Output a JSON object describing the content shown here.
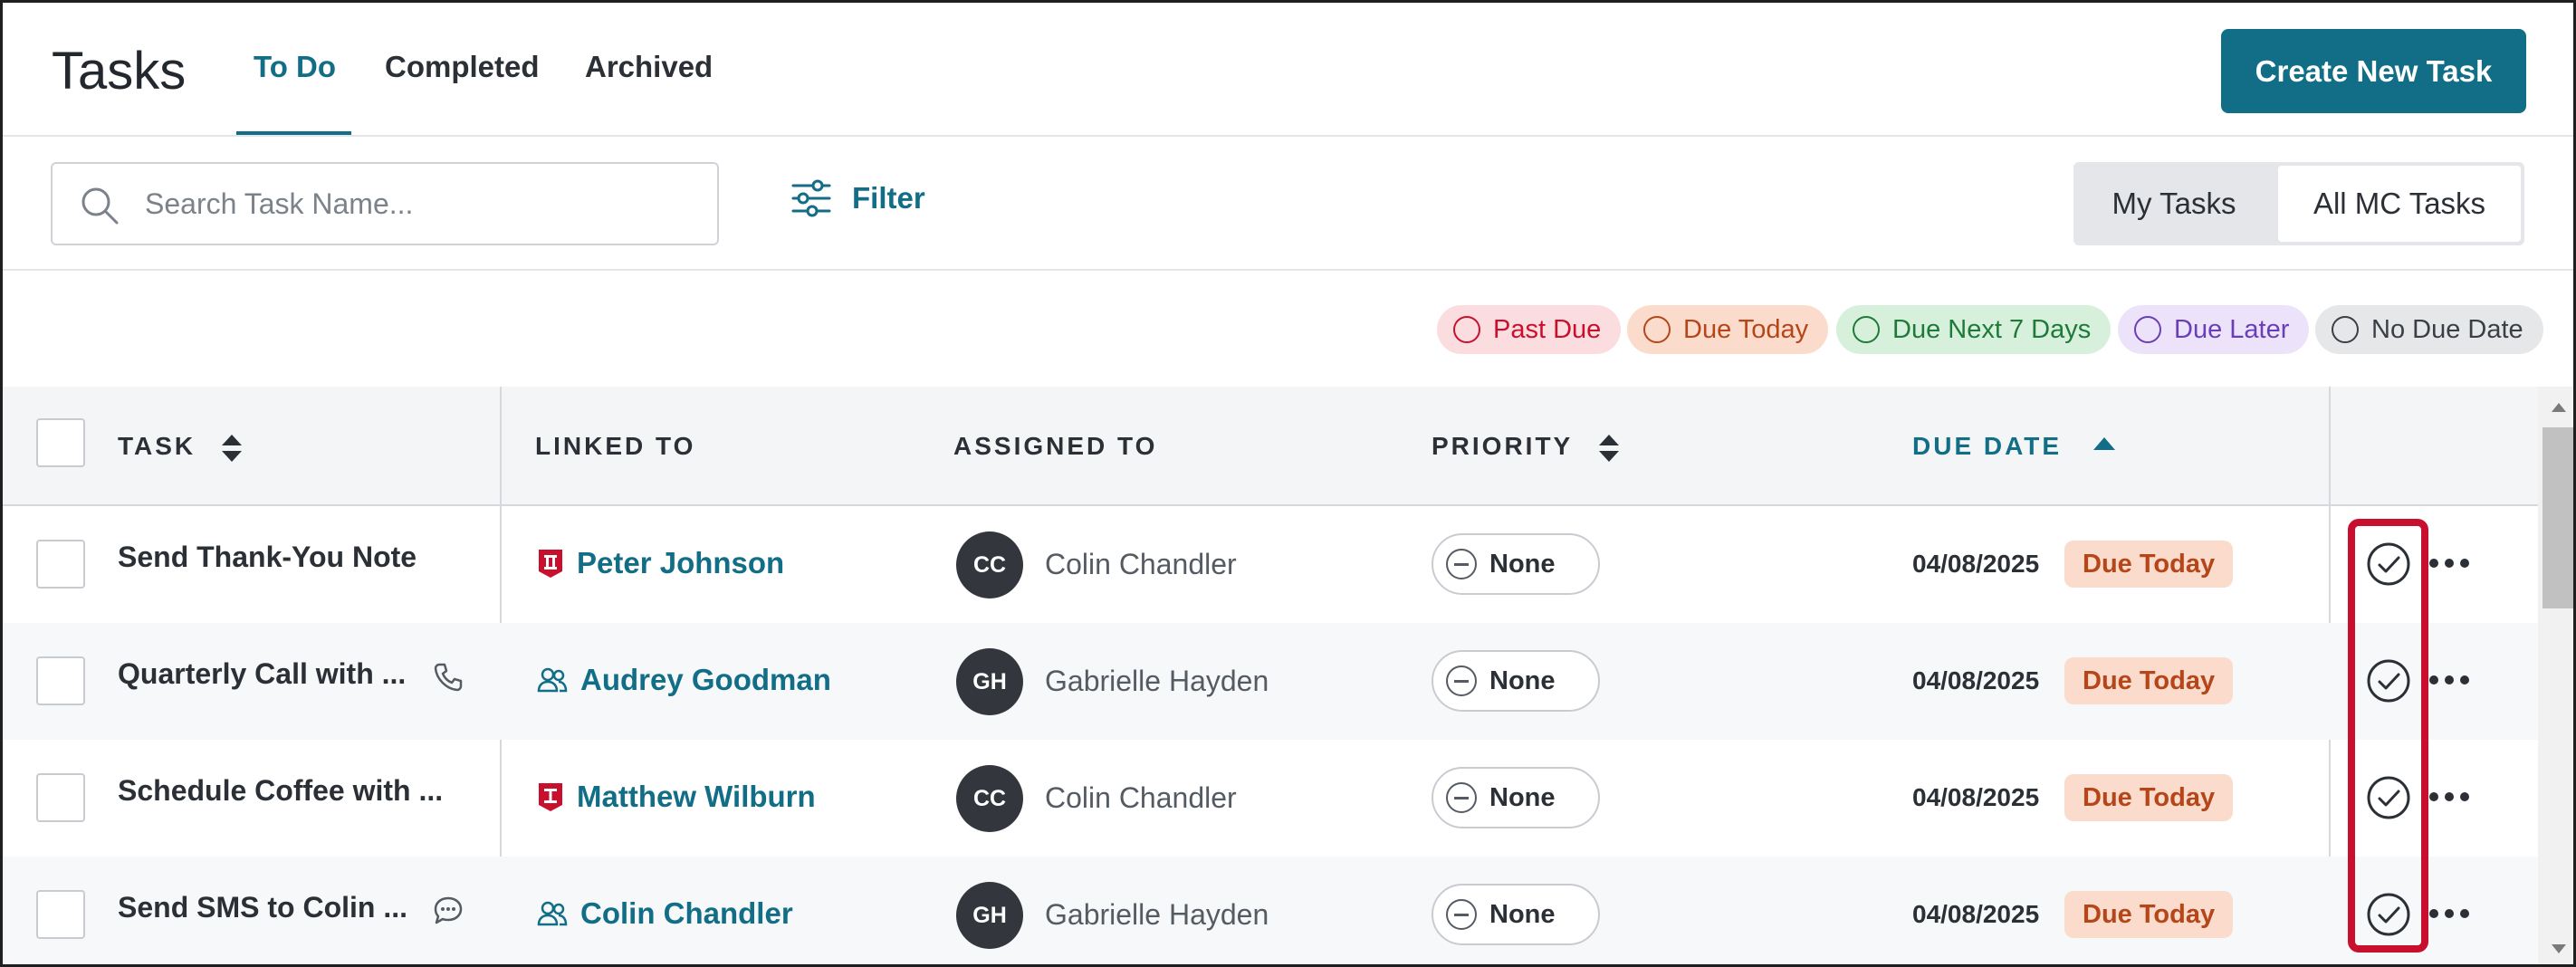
{
  "header": {
    "title": "Tasks",
    "tabs": [
      {
        "label": "To Do",
        "active": true
      },
      {
        "label": "Completed",
        "active": false
      },
      {
        "label": "Archived",
        "active": false
      }
    ],
    "create_button": "Create New Task"
  },
  "toolbar": {
    "search_placeholder": "Search Task Name...",
    "filter_label": "Filter",
    "scope_toggle": [
      {
        "label": "My Tasks",
        "selected": false
      },
      {
        "label": "All MC Tasks",
        "selected": true
      }
    ]
  },
  "legend": [
    {
      "label": "Past Due",
      "color": "#c8102e",
      "bg": "#fbdde0"
    },
    {
      "label": "Due Today",
      "color": "#b4461a",
      "bg": "#fbdccc"
    },
    {
      "label": "Due Next 7 Days",
      "color": "#1f7a3a",
      "bg": "#d7f0dc"
    },
    {
      "label": "Due Later",
      "color": "#6a3fb5",
      "bg": "#ece3fb"
    },
    {
      "label": "No Due Date",
      "color": "#3a3f46",
      "bg": "#e6e7e9"
    }
  ],
  "table": {
    "columns": {
      "task": "TASK",
      "linked_to": "LINKED TO",
      "assigned_to": "ASSIGNED TO",
      "priority": "PRIORITY",
      "due_date": "DUE DATE"
    },
    "sorted_by": "due_date",
    "sort_direction": "ascending",
    "rows": [
      {
        "task": "Send Thank-You Note",
        "task_icon": null,
        "linked_icon": "client-red-icon",
        "linked": "Peter Johnson",
        "avatar": "CC",
        "assignee": "Colin Chandler",
        "priority": "None",
        "due_date": "04/08/2025",
        "due_status": "Due Today"
      },
      {
        "task": "Quarterly Call with ...",
        "task_icon": "phone-icon",
        "linked_icon": "household-icon",
        "linked": "Audrey Goodman",
        "avatar": "GH",
        "assignee": "Gabrielle Hayden",
        "priority": "None",
        "due_date": "04/08/2025",
        "due_status": "Due Today"
      },
      {
        "task": "Schedule Coffee with ...",
        "task_icon": null,
        "linked_icon": "client-red-icon",
        "linked": "Matthew Wilburn",
        "avatar": "CC",
        "assignee": "Colin Chandler",
        "priority": "None",
        "due_date": "04/08/2025",
        "due_status": "Due Today"
      },
      {
        "task": "Send SMS to Colin ...",
        "task_icon": "sms-icon",
        "linked_icon": "household-icon",
        "linked": "Colin Chandler",
        "avatar": "GH",
        "assignee": "Gabrielle Hayden",
        "priority": "None",
        "due_date": "04/08/2025",
        "due_status": "Due Today"
      }
    ]
  },
  "colors": {
    "accent": "#126e86",
    "highlight": "#c8102e",
    "due_today_bg": "#fbdccc",
    "due_today_text": "#b4461a"
  }
}
